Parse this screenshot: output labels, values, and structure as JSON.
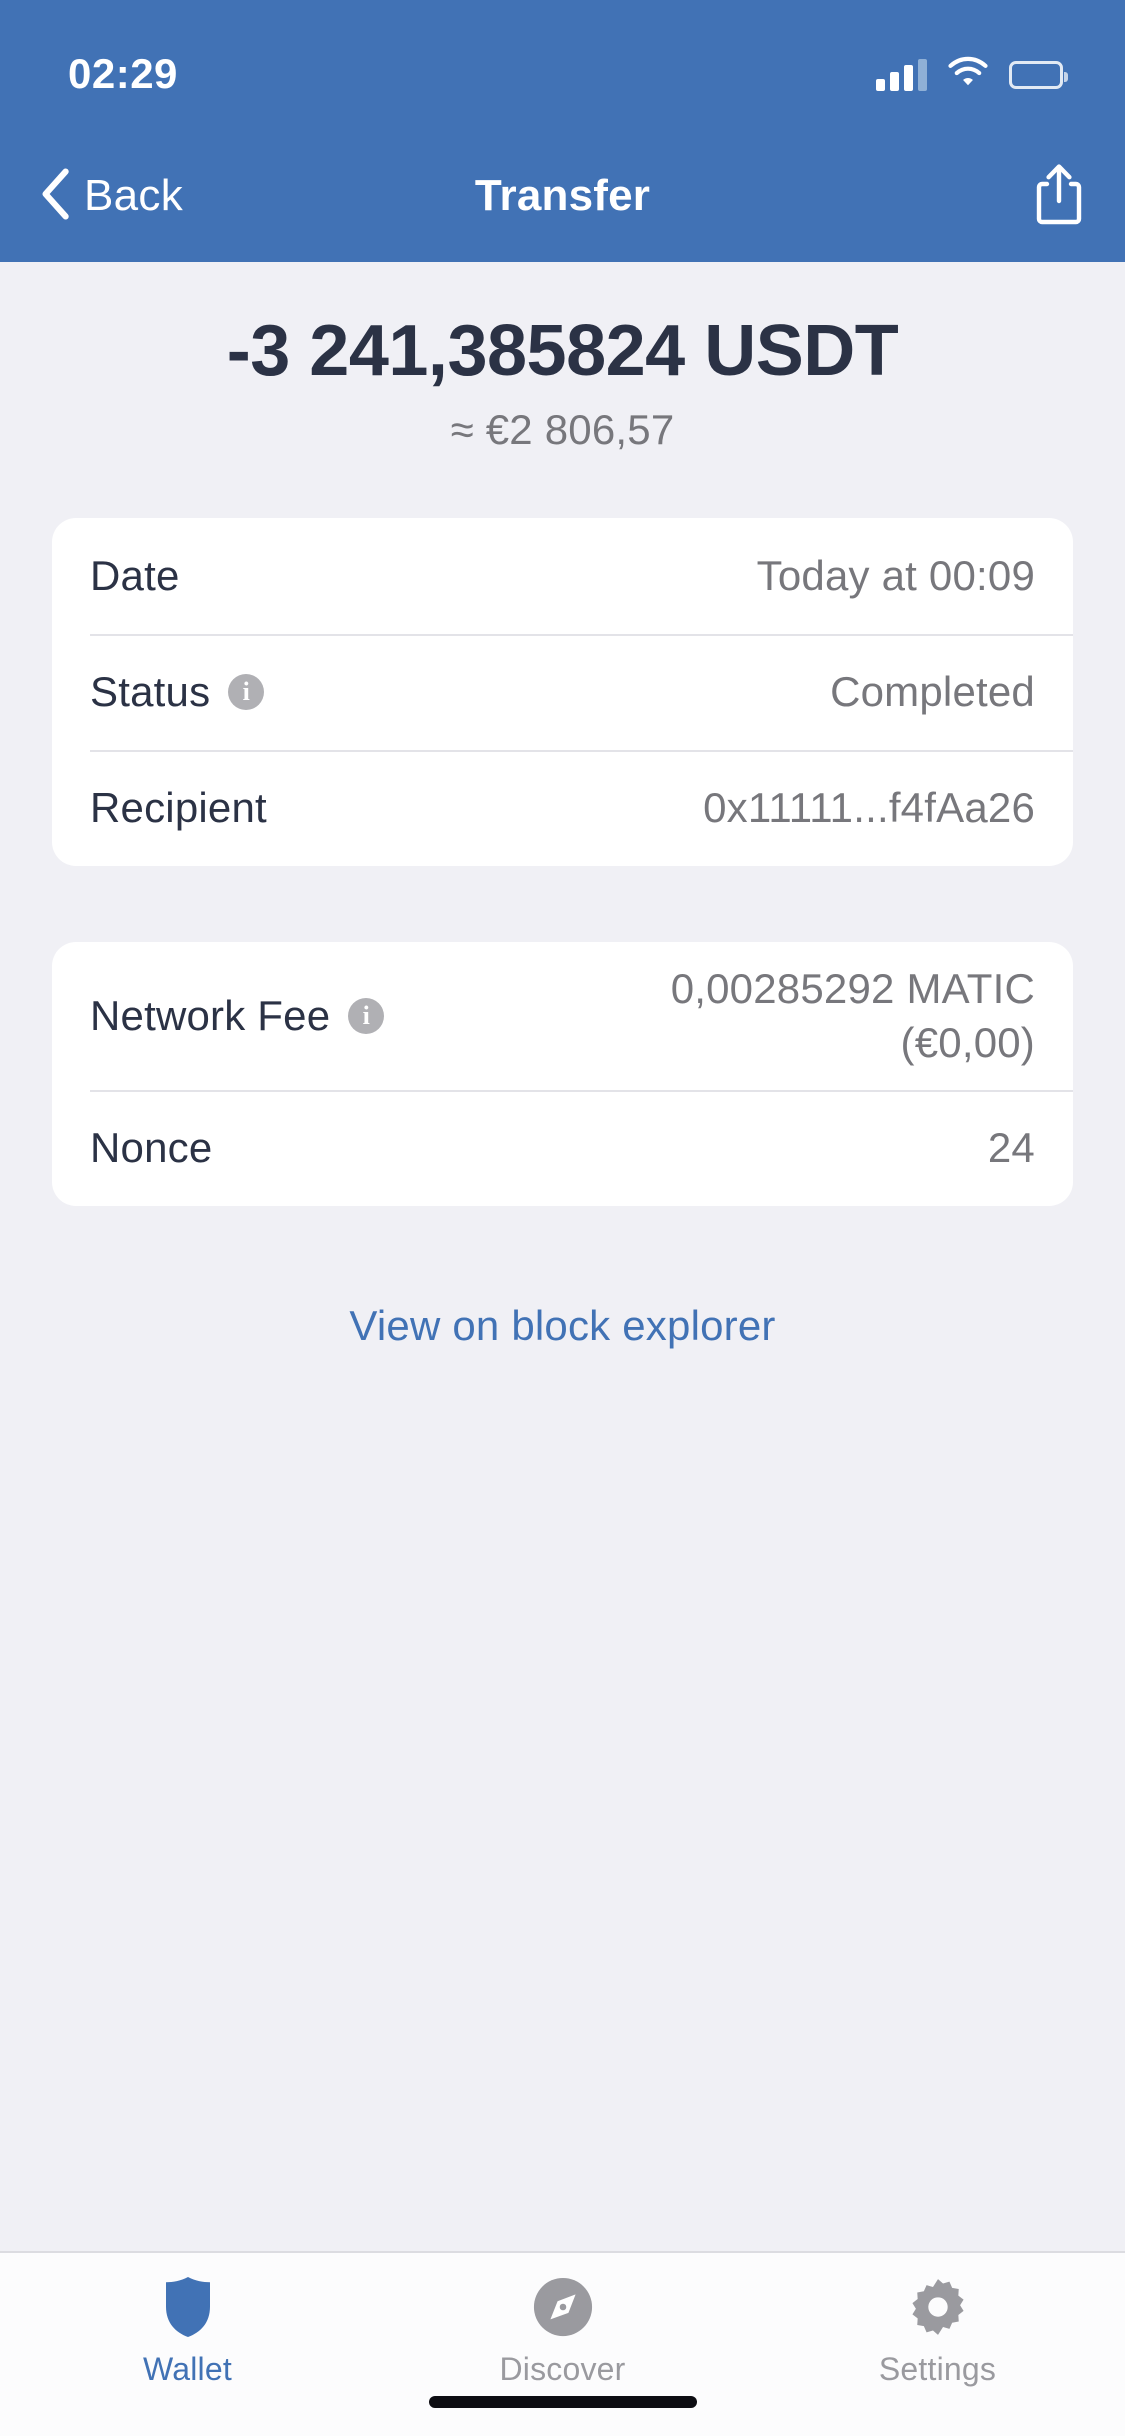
{
  "status_bar": {
    "time": "02:29",
    "cellular_icon": "signal-bars-icon",
    "wifi_icon": "wifi-icon",
    "battery_icon": "battery-icon"
  },
  "nav_bar": {
    "back_label": "Back",
    "back_icon": "chevron-left-icon",
    "title": "Transfer",
    "share_icon": "share-icon"
  },
  "amount": {
    "primary": "-3 241,385824 USDT",
    "fiat": "≈ €2 806,57"
  },
  "details_card": {
    "rows": [
      {
        "label": "Date",
        "value": "Today at 00:09"
      },
      {
        "label": "Status",
        "value": "Completed",
        "info": "i"
      },
      {
        "label": "Recipient",
        "value": "0x11111...f4fAa26"
      }
    ]
  },
  "fee_card": {
    "rows": [
      {
        "label": "Network Fee",
        "value_line1": "0,00285292 MATIC",
        "value_line2": "(€0,00)",
        "info": "i"
      },
      {
        "label": "Nonce",
        "value": "24"
      }
    ]
  },
  "explorer_link": {
    "label": "View on block explorer"
  },
  "tab_bar": {
    "tabs": [
      {
        "label": "Wallet",
        "icon": "shield-icon",
        "active": true
      },
      {
        "label": "Discover",
        "icon": "compass-icon",
        "active": false
      },
      {
        "label": "Settings",
        "icon": "gear-icon",
        "active": false
      }
    ]
  },
  "colors": {
    "header_blue": "#4172b5",
    "page_background": "#f0f0f5",
    "card_white": "#ffffff",
    "text_dark": "#2b3245",
    "text_muted": "#77777c",
    "link_blue": "#4172b5",
    "tab_inactive": "#9a9a9f"
  }
}
